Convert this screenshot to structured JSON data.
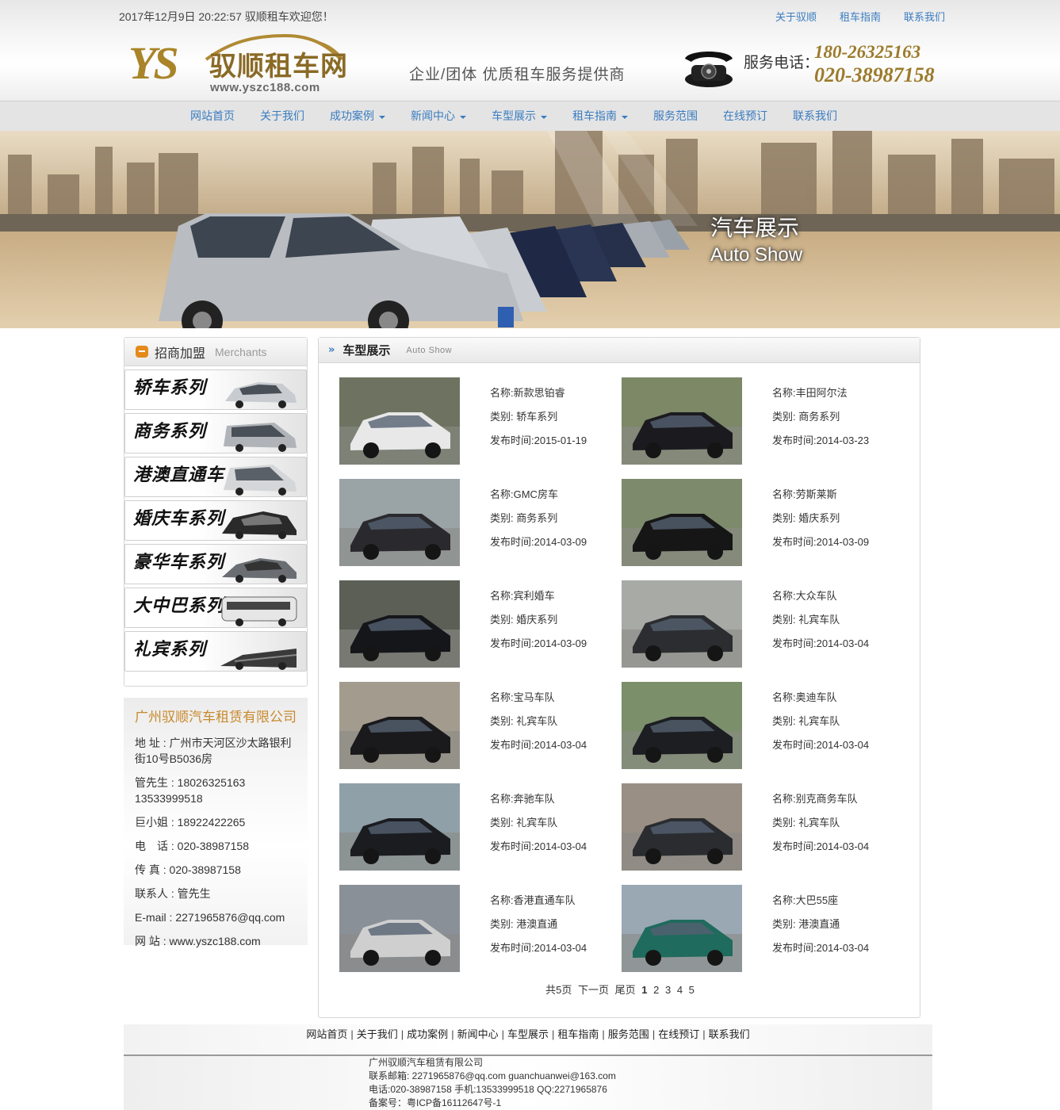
{
  "topbar": {
    "datetime": "2017年12月9日 20:22:57",
    "welcome": "驭顺租车欢迎您！",
    "links": [
      "关于驭顺",
      "租车指南",
      "联系我们"
    ]
  },
  "header": {
    "logo_letters": "YS",
    "brand": "驭顺租车网",
    "url": "www.yszc188.com",
    "slogan": "企业/团体  优质租车服务提供商",
    "service_label": "服务电话：",
    "phone1": "180-26325163",
    "phone2": "020-38987158"
  },
  "nav": {
    "items": [
      {
        "label": "网站首页",
        "dropdown": false
      },
      {
        "label": "关于我们",
        "dropdown": false
      },
      {
        "label": "成功案例",
        "dropdown": true
      },
      {
        "label": "新闻中心",
        "dropdown": true
      },
      {
        "label": "车型展示",
        "dropdown": true
      },
      {
        "label": "租车指南",
        "dropdown": true
      },
      {
        "label": "服务范围",
        "dropdown": false
      },
      {
        "label": "在线预订",
        "dropdown": false
      },
      {
        "label": "联系我们",
        "dropdown": false
      }
    ]
  },
  "banner": {
    "title": "汽车展示",
    "subtitle": "Auto Show"
  },
  "sidebar": {
    "title": "招商加盟",
    "title_en": "Merchants",
    "series": [
      "轿车系列",
      "商务系列",
      "港澳直通车",
      "婚庆车系列",
      "豪华车系列",
      "大中巴系列",
      "礼宾系列"
    ]
  },
  "contact": {
    "company": "广州驭顺汽车租赁有限公司",
    "address": "地 址 : 广州市天河区沙太路银利街10号B5036房",
    "mr_guan": "管先生 : 18026325163 13533999518",
    "ms_ju": "巨小姐 : 18922422265",
    "tel": "电　话 : 020-38987158",
    "fax": "传 真 : 020-38987158",
    "contact_person": "联系人 : 管先生",
    "email": "E-mail : 2271965876@qq.com",
    "website": "网 站 : www.yszc188.com"
  },
  "main": {
    "title": "车型展示",
    "title_en": "Auto Show",
    "cars": [
      {
        "name": "名称:新款思铂睿",
        "type": "类别: 轿车系列",
        "date": "发布时间:2015-01-19",
        "color": "#e8e8e8",
        "bg": "#6d7360"
      },
      {
        "name": "名称:丰田阿尔法",
        "type": "类别: 商务系列",
        "date": "发布时间:2014-03-23",
        "color": "#1b1b1f",
        "bg": "#7c8866"
      },
      {
        "name": "名称:GMC房车",
        "type": "类别: 商务系列",
        "date": "发布时间:2014-03-09",
        "color": "#2a2a2e",
        "bg": "#9aa3a6"
      },
      {
        "name": "名称:劳斯莱斯",
        "type": "类别: 婚庆系列",
        "date": "发布时间:2014-03-09",
        "color": "#161616",
        "bg": "#7d8a6c"
      },
      {
        "name": "名称:宾利婚车",
        "type": "类别: 婚庆系列",
        "date": "发布时间:2014-03-09",
        "color": "#14161a",
        "bg": "#5b5f56"
      },
      {
        "name": "名称:大众车队",
        "type": "类别: 礼宾车队",
        "date": "发布时间:2014-03-04",
        "color": "#2b2d30",
        "bg": "#a8aaa6"
      },
      {
        "name": "名称:宝马车队",
        "type": "类别: 礼宾车队",
        "date": "发布时间:2014-03-04",
        "color": "#1a1a1c",
        "bg": "#a39b8e"
      },
      {
        "name": "名称:奥迪车队",
        "type": "类别: 礼宾车队",
        "date": "发布时间:2014-03-04",
        "color": "#1c1e22",
        "bg": "#7b8f6a"
      },
      {
        "name": "名称:奔驰车队",
        "type": "类别: 礼宾车队",
        "date": "发布时间:2014-03-04",
        "color": "#1a1c20",
        "bg": "#8fa0a8"
      },
      {
        "name": "名称:别克商务车队",
        "type": "类别: 礼宾车队",
        "date": "发布时间:2014-03-04",
        "color": "#2a2c30",
        "bg": "#9a8f84"
      },
      {
        "name": "名称:香港直通车队",
        "type": "类别: 港澳直通",
        "date": "发布时间:2014-03-04",
        "color": "#cfcfcf",
        "bg": "#8a9098"
      },
      {
        "name": "名称:大巴55座",
        "type": "类别: 港澳直通",
        "date": "发布时间:2014-03-04",
        "color": "#1f6b5e",
        "bg": "#9aa8b4"
      }
    ]
  },
  "pager": {
    "total": "共5页",
    "next": "下一页",
    "last": "尾页",
    "current": "1",
    "pages": [
      "2",
      "3",
      "4",
      "5"
    ]
  },
  "footer": {
    "links": [
      "网站首页",
      "关于我们",
      "成功案例",
      "新闻中心",
      "车型展示",
      "租车指南",
      "服务范围",
      "在线预订",
      "联系我们"
    ],
    "company": "广州驭顺汽车租赁有限公司",
    "email_line": "联系邮箱: 2271965876@qq.com guanchuanwei@163.com",
    "phone_line": "电话:020-38987158 手机:13533999518 QQ:2271965876",
    "icp_line": "备案号：粤ICP备16112647号-1"
  }
}
